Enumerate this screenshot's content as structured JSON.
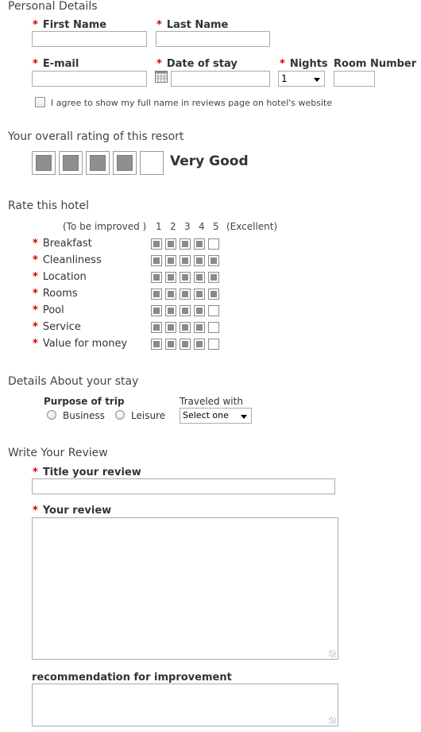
{
  "personal": {
    "section_title": "Personal Details",
    "first_name_label": "First Name",
    "last_name_label": "Last Name",
    "email_label": "E-mail",
    "date_label": "Date of stay",
    "nights_label": "Nights",
    "nights_value": "1",
    "room_label": "Room Number",
    "agree_text": "I agree to show my full name in reviews page on hotel's website",
    "required_mark": "*"
  },
  "overall": {
    "section_title": "Your overall rating of this resort",
    "rating": 4,
    "max": 5,
    "rating_text": "Very Good"
  },
  "rate": {
    "section_title": "Rate this hotel",
    "scale_low": "(To be improved )",
    "scale_nums": [
      "1",
      "2",
      "3",
      "4",
      "5"
    ],
    "scale_high": "(Excellent)",
    "criteria": [
      {
        "label": "Breakfast",
        "value": 4
      },
      {
        "label": "Cleanliness",
        "value": 5
      },
      {
        "label": "Location",
        "value": 5
      },
      {
        "label": "Rooms",
        "value": 5
      },
      {
        "label": "Pool",
        "value": 4
      },
      {
        "label": "Service",
        "value": 4
      },
      {
        "label": "Value for money",
        "value": 4
      }
    ]
  },
  "stay": {
    "section_title": "Details About your stay",
    "purpose_label": "Purpose of trip",
    "opt_business": "Business",
    "opt_leisure": "Leisure",
    "traveled_label": "Traveled with",
    "traveled_value": "Select one"
  },
  "review": {
    "section_title": "Write Your Review",
    "title_label": "Title your review",
    "review_label": "Your review",
    "recommend_label": "recommendation for improvement"
  },
  "colors": {
    "required": "#cc0000",
    "box_fill": "#8a8a8a",
    "border": "#a5acb2"
  }
}
